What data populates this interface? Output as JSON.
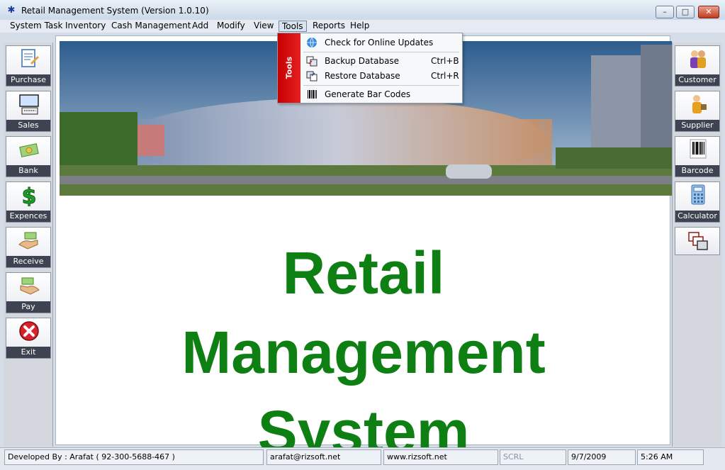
{
  "window": {
    "title": "Retail Management System (Version 1.0.10)"
  },
  "menu": [
    "System Task",
    "Inventory",
    "Cash Management",
    "Add",
    "Modify",
    "View",
    "Tools",
    "Reports",
    "Help"
  ],
  "tools_menu": {
    "side_label": "Tools",
    "items": [
      {
        "label": "Check for Online Updates",
        "shortcut": ""
      },
      {
        "label": "Backup Database",
        "shortcut": "Ctrl+B"
      },
      {
        "label": "Restore Database",
        "shortcut": "Ctrl+R"
      },
      {
        "label": "Generate Bar Codes",
        "shortcut": ""
      }
    ]
  },
  "left_toolbar": [
    "Purchase",
    "Sales",
    "Bank",
    "Expences",
    "Receive",
    "Pay",
    "Exit"
  ],
  "right_toolbar": [
    "Customer",
    "Supplier",
    "Barcode",
    "Calculator",
    ""
  ],
  "main": {
    "headline": [
      "Retail",
      "Management",
      "System"
    ]
  },
  "status": {
    "developer": "Developed By : Arafat ( 92-300-5688-467 )",
    "email": "arafat@rizsoft.net",
    "website": "www.rizsoft.net",
    "scrl": "SCRL",
    "date": "9/7/2009",
    "time": "5:26 AM"
  },
  "colors": {
    "headline": "#0e7f12",
    "tools_stripe": "#d01010",
    "label_bar": "#3d4350"
  }
}
